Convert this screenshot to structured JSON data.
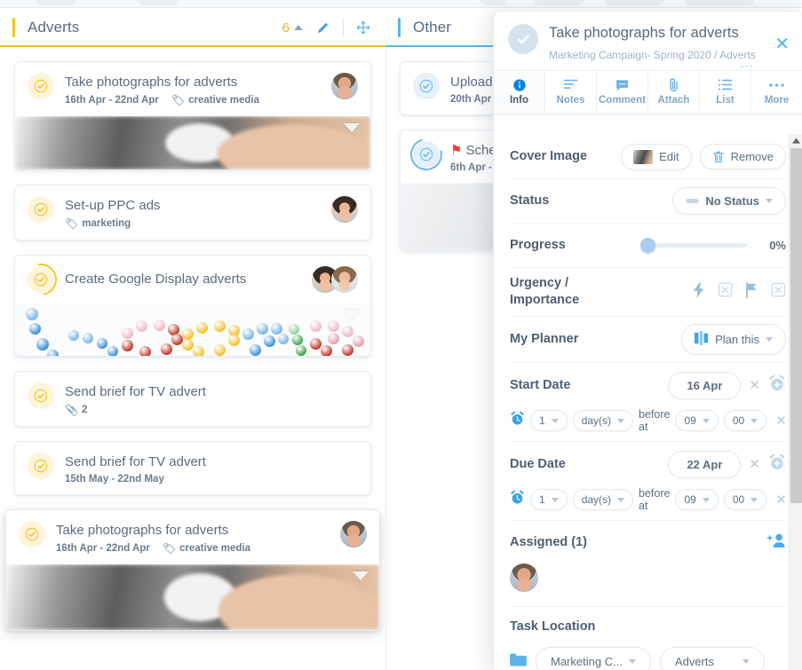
{
  "board": {
    "columns": [
      {
        "name": "Adverts",
        "title": "Adverts",
        "count": "6",
        "accent": "#f0c419",
        "edit_icon": "pencil-icon",
        "move_icon": "move-icon",
        "collapse_icon": "caret-up-icon",
        "cards": [
          {
            "title": "Take photographs for adverts",
            "dates": "16th Apr - 22nd Apr",
            "tag": "creative media",
            "check_style": "amber",
            "avatars": [
              "face-m1"
            ],
            "cover": "photo",
            "dragging": false
          },
          {
            "title": "Set-up PPC ads",
            "dates": "",
            "tag": "marketing",
            "check_style": "amber",
            "avatars": [
              "face-f1"
            ],
            "cover": "",
            "dragging": false
          },
          {
            "title": "Create Google Display adverts",
            "dates": "",
            "tag": "",
            "check_style": "amber-ring",
            "avatars": [
              "face-f1",
              "face-f2"
            ],
            "cover": "google",
            "dragging": false
          },
          {
            "title": "Send brief for TV advert",
            "dates": "",
            "tag": "",
            "attachments": "2",
            "check_style": "amber",
            "avatars": [],
            "cover": "",
            "dragging": false
          },
          {
            "title": "Send brief for TV advert",
            "dates": "15th May - 22nd May",
            "tag": "",
            "check_style": "amber",
            "avatars": [],
            "cover": "",
            "dragging": false
          },
          {
            "title": "Take photographs for adverts",
            "dates": "16th Apr - 22nd Apr",
            "tag": "creative media",
            "check_style": "amber",
            "avatars": [
              "face-m1"
            ],
            "cover": "photo",
            "dragging": true
          }
        ]
      },
      {
        "name": "Other",
        "title": "Other",
        "count": "",
        "accent": "#5bb4e8",
        "cards": [
          {
            "title": "Upload",
            "dates": "20th Apr",
            "tag": "",
            "check_style": "blue",
            "avatars": [],
            "cover": "",
            "dragging": false
          },
          {
            "title": "Sche",
            "flag": "⚑",
            "dates": "6th Apr -",
            "tag": "",
            "check_style": "blue-ring",
            "avatars": [],
            "cover": "phone",
            "dragging": false
          }
        ]
      }
    ]
  },
  "panel": {
    "title": "Take photographs for adverts",
    "breadcrumb": "Marketing Campaign- Spring 2020 / Adverts",
    "close_icon": "close-icon",
    "ellipsis_icon": "ellipsis-icon",
    "complete_icon": "check-circle-icon",
    "tabs": [
      {
        "label": "Info",
        "icon": "info-icon",
        "active": true
      },
      {
        "label": "Notes",
        "icon": "notes-icon",
        "active": false
      },
      {
        "label": "Comment",
        "icon": "comment-icon",
        "active": false
      },
      {
        "label": "Attach",
        "icon": "paperclip-icon",
        "active": false
      },
      {
        "label": "List",
        "icon": "list-icon",
        "active": false
      },
      {
        "label": "More",
        "icon": "more-icon",
        "active": false
      }
    ],
    "rows": {
      "cover_image": {
        "label": "Cover Image",
        "edit_label": "Edit",
        "remove_label": "Remove"
      },
      "status": {
        "label": "Status",
        "value": "No Status"
      },
      "progress": {
        "label": "Progress",
        "value": "0%",
        "percent": 0
      },
      "urgency": {
        "label": "Urgency / Importance",
        "icons": [
          "lightning-icon",
          "clear-urgency-icon",
          "flag-icon",
          "clear-importance-icon"
        ]
      },
      "planner": {
        "label": "My Planner",
        "value": "Plan this",
        "icon": "planner-icon"
      },
      "start_date": {
        "label": "Start Date",
        "value": "16 Apr",
        "clear_icon": "close-icon",
        "alarm_add_icon": "alarm-add-icon",
        "reminder": {
          "alarm_icon": "alarm-icon",
          "amount": "1",
          "unit": "day(s)",
          "text": "before at",
          "hour": "09",
          "minute": "00",
          "clear_icon": "close-icon"
        }
      },
      "due_date": {
        "label": "Due Date",
        "value": "22 Apr",
        "clear_icon": "close-icon",
        "alarm_add_icon": "alarm-add-icon",
        "reminder": {
          "alarm_icon": "alarm-icon",
          "amount": "1",
          "unit": "day(s)",
          "text": "before at",
          "hour": "09",
          "minute": "00",
          "clear_icon": "close-icon"
        }
      },
      "assigned": {
        "label": "Assigned (1)",
        "add_icon": "add-user-icon",
        "members": [
          "face-m1"
        ]
      },
      "task_location": {
        "label": "Task Location",
        "folder_icon": "folder-icon",
        "project": "Marketing C...",
        "list": "Adverts"
      }
    }
  },
  "colors": {
    "accent_amber": "#f0c419",
    "accent_blue": "#5bb4e8",
    "link_blue": "#55b2f0",
    "text": "#566a7e",
    "flag_red": "#f0412f"
  }
}
